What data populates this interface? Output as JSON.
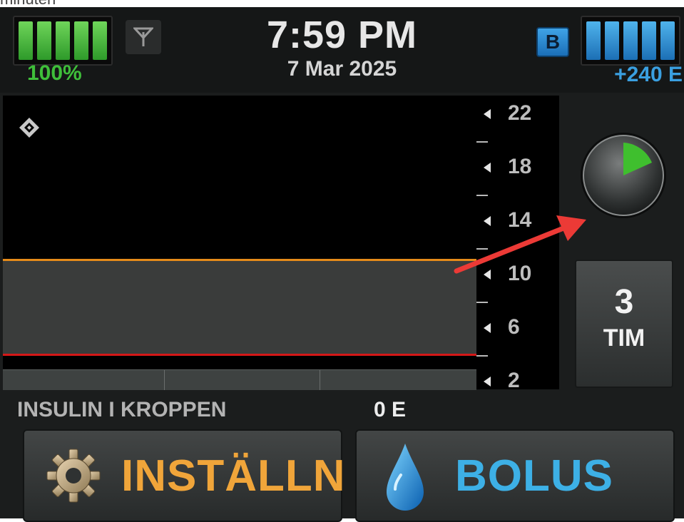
{
  "top_caption": "minuten",
  "status": {
    "battery_percent": "100%",
    "battery_level": 1.0,
    "time": "7:59 PM",
    "date": "7 Mar 2025",
    "badge_letter": "B",
    "insulin_units": "+240 E",
    "reservoir_level": 1.0
  },
  "graph": {
    "y_ticks": [
      "22",
      "18",
      "14",
      "10",
      "6",
      "2"
    ],
    "high_line_color": "#e58b1a",
    "low_line_color": "#d41818"
  },
  "right_panel": {
    "timer_value": "3",
    "timer_unit": "TIM"
  },
  "iob": {
    "label": "INSULIN I KROPPEN",
    "value": "0 E"
  },
  "buttons": {
    "settings_label": "INSTÄLLN",
    "bolus_label": "BOLUS"
  },
  "icons": {
    "antenna": "antenna-icon",
    "diamond": "diamond-icon",
    "clock": "clock-icon",
    "gear": "gear-icon",
    "drop": "drop-icon"
  }
}
